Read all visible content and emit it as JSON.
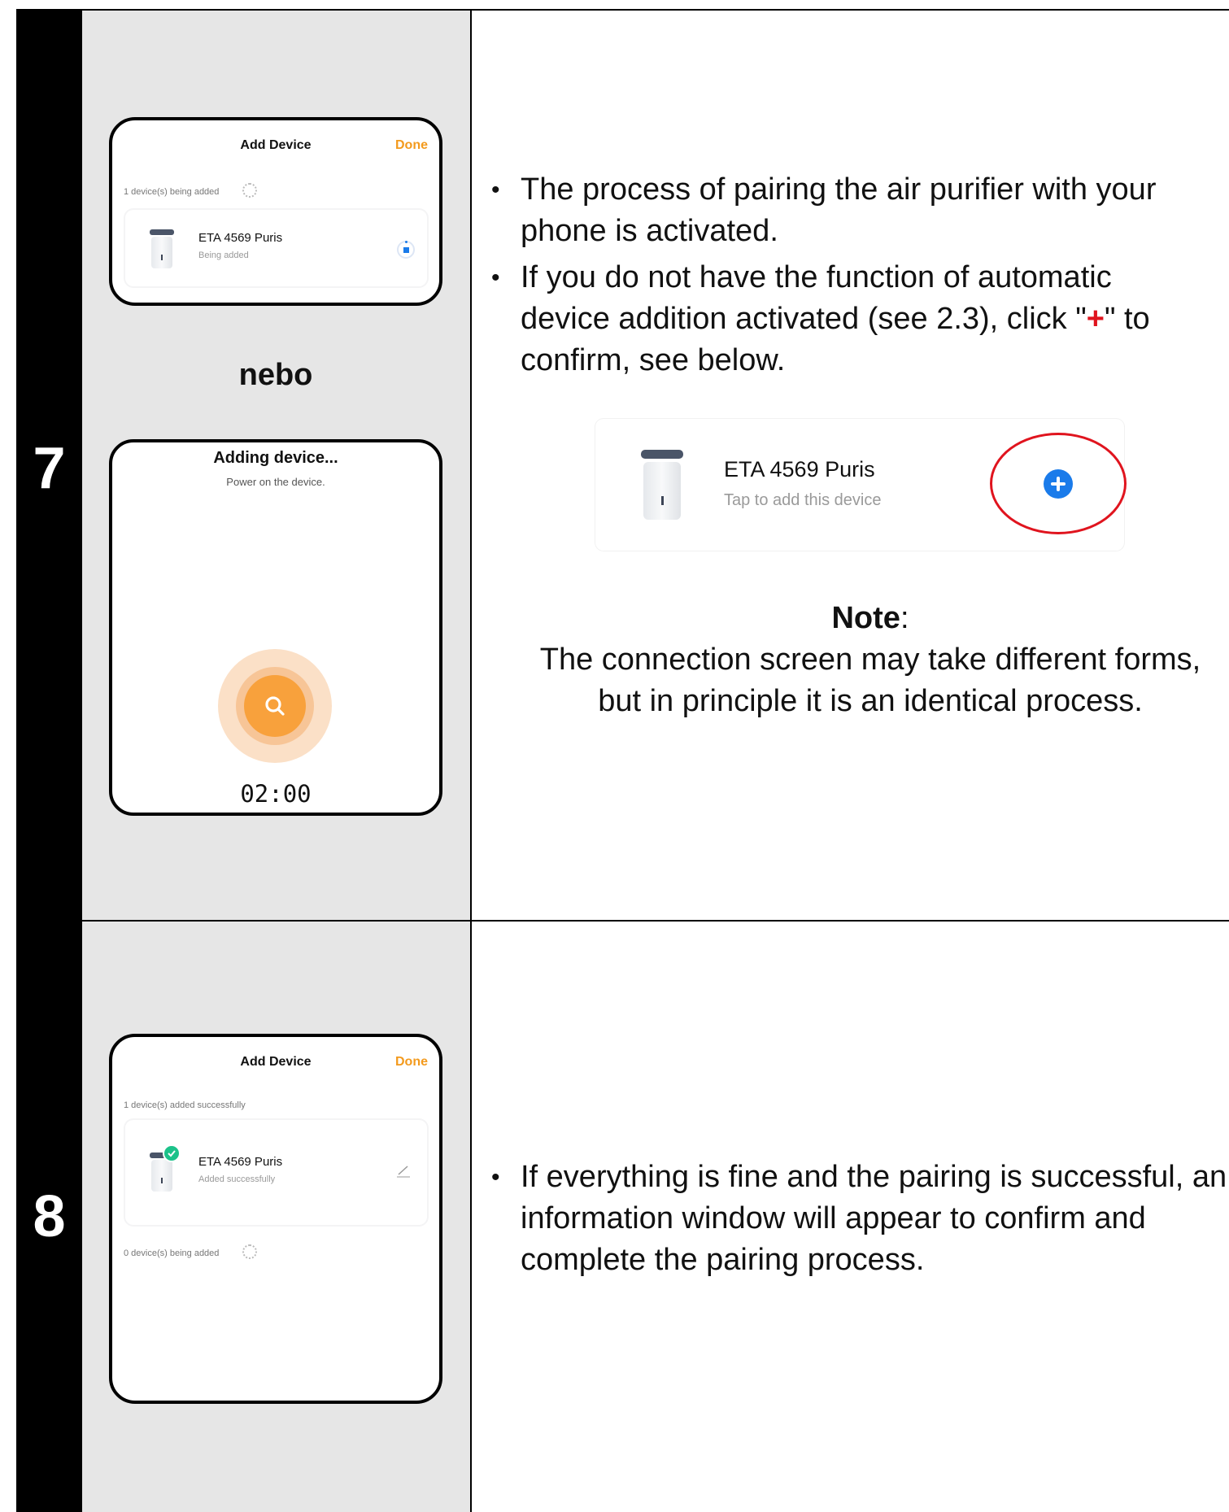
{
  "steps": {
    "step7": {
      "number": "7",
      "screen1": {
        "title": "Add Device",
        "done": "Done",
        "status": "1 device(s) being added",
        "device_name": "ETA 4569 Puris",
        "device_status": "Being added"
      },
      "separator": "nebo",
      "screen2": {
        "title": "Adding device...",
        "subtitle": "Power on the device.",
        "timer": "02:00"
      },
      "bullets": [
        "The process of pairing the air purifier with your phone is activated.",
        "If you do not have the function of automatic device addition activated (see 2.3), click \"",
        "+",
        "\" to confirm, see below."
      ],
      "example_card": {
        "device_name": "ETA 4569 Puris",
        "device_hint": "Tap to add this device"
      },
      "note": {
        "label": "Note",
        "colon": ":",
        "text": "The connection screen may take different forms, but in principle it is an identical process."
      }
    },
    "step8": {
      "number": "8",
      "screen": {
        "title": "Add Device",
        "done": "Done",
        "status_success": "1 device(s) added successfully",
        "device_name": "ETA 4569 Puris",
        "device_status": "Added successfully",
        "status_pending": "0 device(s) being added"
      },
      "bullets": [
        "If everything is fine and the pairing is successful, an information window will appear to confirm and complete the pairing process."
      ]
    }
  },
  "colors": {
    "accent_orange": "#f39a1d",
    "plus_blue": "#1a7bea",
    "highlight_red": "#e0141e",
    "success_green": "#1cc28a"
  },
  "icons": [
    "search-icon",
    "plus-circle-icon",
    "check-badge-icon",
    "edit-pencil-icon",
    "loading-spinner-icon"
  ]
}
